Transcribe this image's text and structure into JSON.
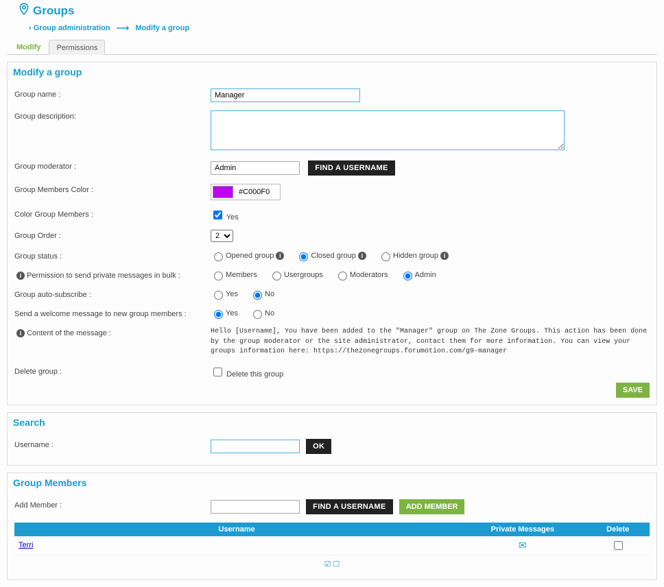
{
  "header": {
    "title": "Groups",
    "breadcrumb": [
      "Group administration",
      "Modify a group"
    ]
  },
  "tabs": [
    "Modify",
    "Permissions"
  ],
  "modify": {
    "title": "Modify a group",
    "labels": {
      "group_name": "Group name :",
      "group_description": "Group description:",
      "group_moderator": "Group moderator :",
      "find_username": "FIND A USERNAME",
      "members_color": "Group Members Color :",
      "color_members": "Color Group Members :",
      "color_yes": "Yes",
      "group_order": "Group Order :",
      "group_status": "Group status :",
      "status_opened": "Opened group",
      "status_closed": "Closed group",
      "status_hidden": "Hidden group",
      "pm_perm": "Permission to send private messages in bulk :",
      "pm_members": "Members",
      "pm_usergroups": "Usergroups",
      "pm_moderators": "Moderators",
      "pm_admin": "Admin",
      "auto_sub": "Group auto-subscribe :",
      "yes": "Yes",
      "no": "No",
      "welcome": "Send a welcome message to new group members :",
      "message_content": "Content of the message :",
      "delete_group": "Delete group :",
      "delete_this": "Delete this group",
      "save": "SAVE"
    },
    "values": {
      "group_name": "Manager",
      "moderator": "Admin",
      "color_hex": "#C000F0",
      "color_swatch": "#C000F0",
      "order": "2",
      "message": "Hello [Username], You have been added to the \"Manager\" group on The Zone Groups. This action has been done by the group moderator or the site administrator, contact them for more information. You can view your groups information here: https://thezonegroups.forumotion.com/g9-manager"
    }
  },
  "search": {
    "title": "Search",
    "username_label": "Username :",
    "ok": "OK"
  },
  "members": {
    "title": "Group Members",
    "add_label": "Add Member :",
    "find_username": "FIND A USERNAME",
    "add_member": "ADD MEMBER",
    "columns": [
      "Username",
      "Private Messages",
      "Delete"
    ],
    "rows": [
      {
        "username": "Terri"
      }
    ]
  }
}
